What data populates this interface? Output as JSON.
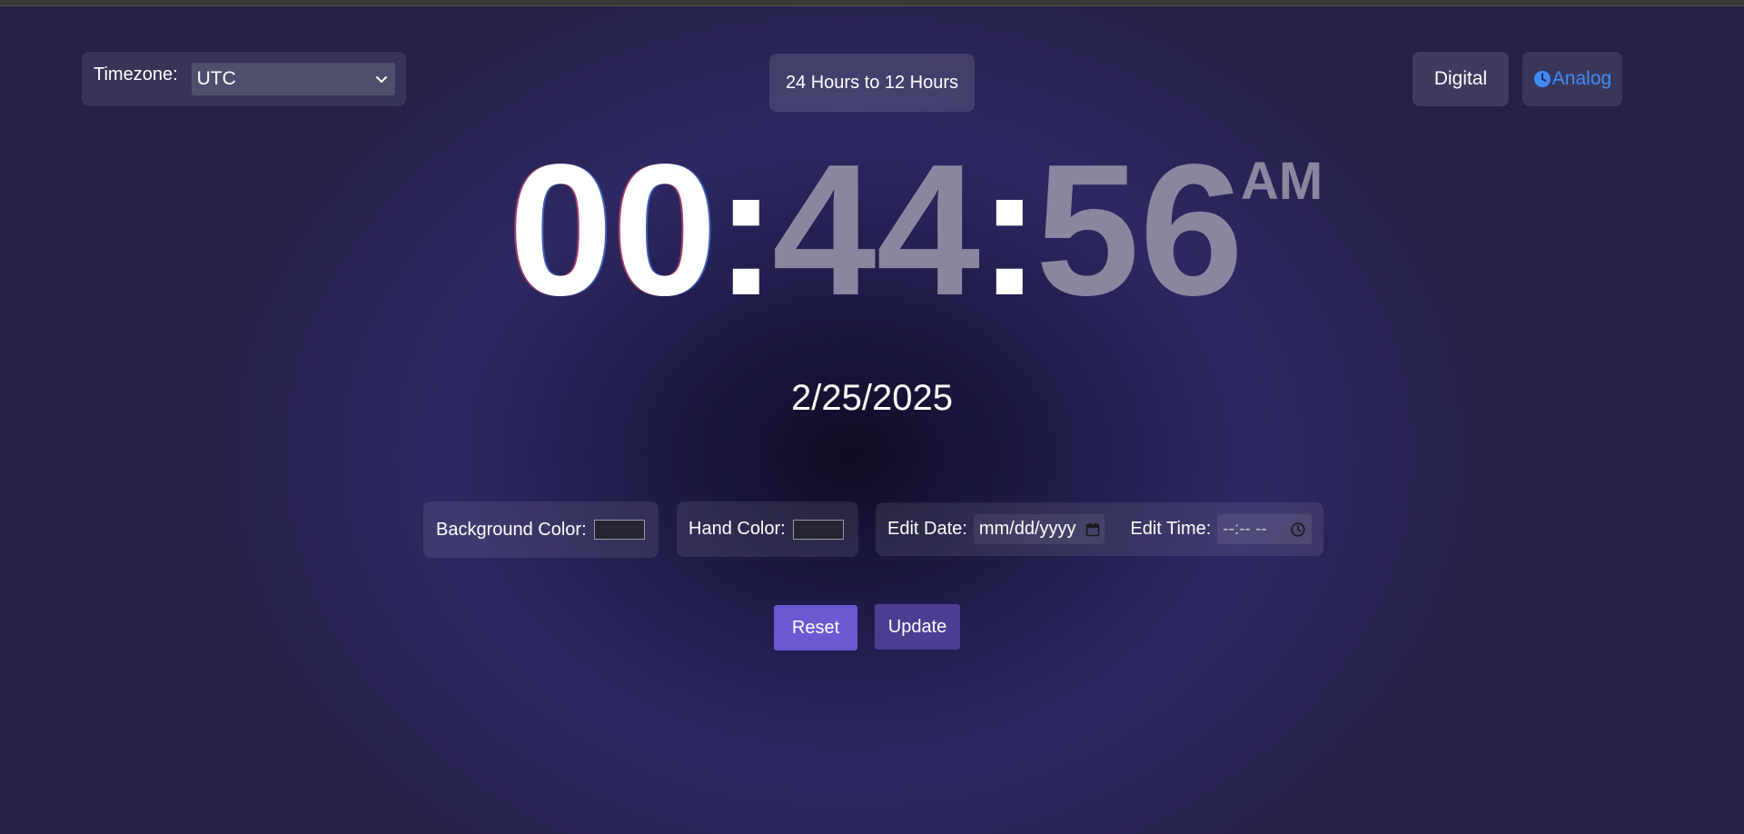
{
  "timezone": {
    "label": "Timezone:",
    "selected": "UTC"
  },
  "format_toggle": {
    "label": "24 Hours to 12 Hours"
  },
  "view_buttons": {
    "digital_label": "Digital",
    "analog_label": "Analog",
    "analog_icon": "clock-icon"
  },
  "clock": {
    "hours": "00",
    "separator": ":",
    "minutes": "44",
    "seconds": "56",
    "period": "AM"
  },
  "date": "2/25/2025",
  "controls": {
    "background_color_label": "Background Color:",
    "hand_color_label": "Hand Color:",
    "edit_date_label": "Edit Date:",
    "edit_date_placeholder": "mm/dd/yyyy",
    "edit_time_label": "Edit Time:",
    "edit_time_placeholder": "--:-- --"
  },
  "actions": {
    "reset_label": "Reset",
    "update_label": "Update"
  },
  "colors": {
    "accent_link": "#3f8cf5",
    "reset_button": "#6b59d3",
    "update_button": "#4c3d92",
    "dim_digits": "#8a86a0"
  }
}
